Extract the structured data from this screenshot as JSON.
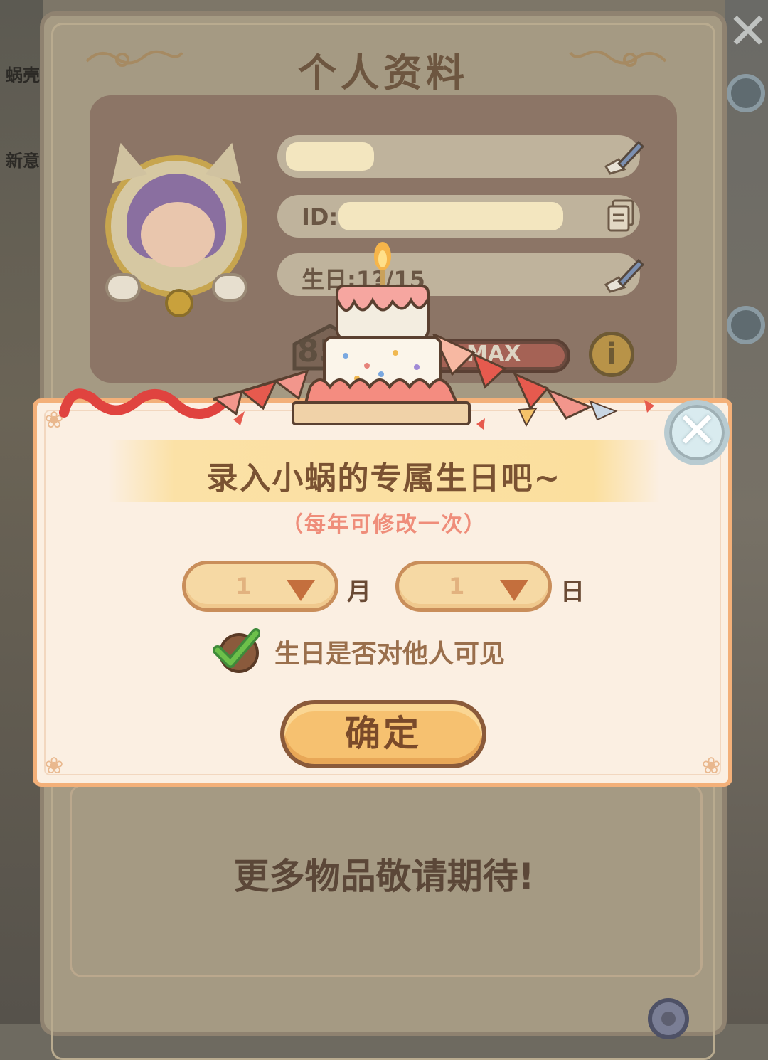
{
  "background": {
    "left_labels": [
      "蜗壳",
      "新意"
    ]
  },
  "profile": {
    "title": "个人资料",
    "close_symbol": "✕",
    "birthday_prefix": "生日:",
    "birthday_value": "1?/15",
    "id_prefix": "ID:",
    "level_text": "85",
    "exp_label": "MAX",
    "info_symbol": "i",
    "coming_soon": "更多物品敬请期待!"
  },
  "dialog": {
    "title": "录入小蜗的专属生日吧~",
    "subtitle": "（每年可修改一次）",
    "month_value": "1",
    "month_unit": "月",
    "day_value": "1",
    "day_unit": "日",
    "visibility_label": "生日是否对他人可见",
    "visibility_checked": true,
    "confirm_label": "确定",
    "close_symbol": "✕"
  },
  "colors": {
    "dialog_bg": "#fbefe2",
    "dialog_border": "#f3b079",
    "title_text": "#7a5232",
    "subtitle_text": "#ef8d7a",
    "confirm_bg": "#f6c170",
    "checkbox_green": "#4caf50"
  },
  "icons": [
    "close-icon",
    "edit-pencil-icon",
    "copy-icon",
    "info-icon",
    "dropdown-arrow-icon",
    "check-icon",
    "gear-icon",
    "birthday-cake-icon"
  ]
}
